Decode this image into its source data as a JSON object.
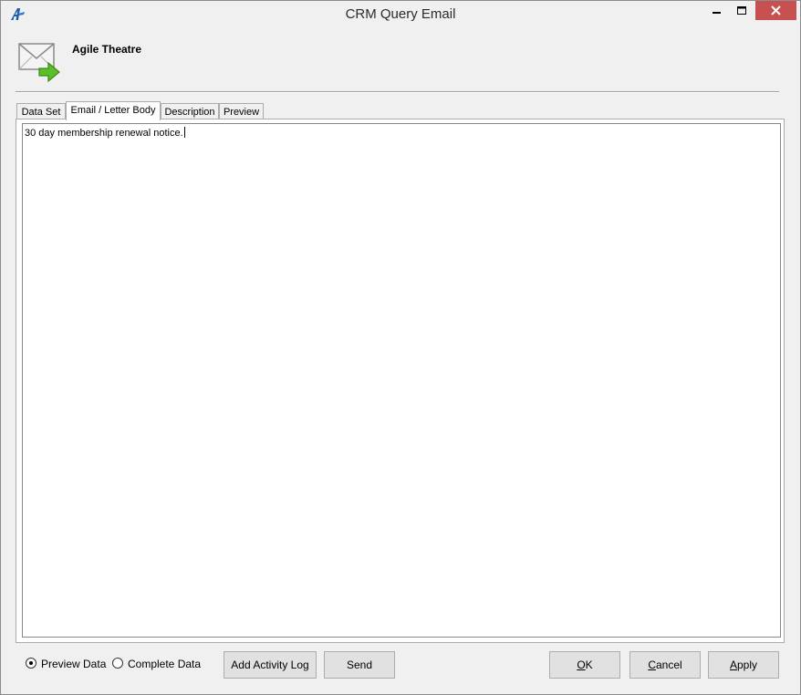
{
  "window": {
    "title": "CRM Query Email",
    "controls": {
      "minimize_icon": "minimize-icon",
      "maximize_icon": "maximize-icon",
      "close_icon": "close-icon",
      "close_color": "#c75050"
    }
  },
  "header": {
    "icon": "email-send-icon",
    "title": "Agile Theatre"
  },
  "tabs": [
    {
      "label": "Data Set",
      "active": false
    },
    {
      "label": "Email / Letter Body",
      "active": true
    },
    {
      "label": "Description",
      "active": false
    },
    {
      "label": "Preview",
      "active": false
    }
  ],
  "body": {
    "text": "30 day membership renewal notice."
  },
  "footer": {
    "radios": [
      {
        "label": "Preview Data",
        "selected": true
      },
      {
        "label": "Complete Data",
        "selected": false
      }
    ],
    "buttons": {
      "add_activity_log": "Add Activity Log",
      "send": "Send",
      "ok": {
        "mnemonic": "O",
        "rest": "K"
      },
      "cancel": {
        "mnemonic": "C",
        "rest": "ancel"
      },
      "apply": {
        "mnemonic": "A",
        "rest": "pply"
      }
    }
  }
}
